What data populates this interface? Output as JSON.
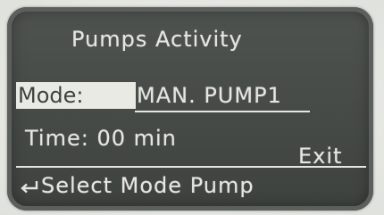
{
  "screen": {
    "title": "Pumps Activity",
    "mode_label": "Mode:",
    "mode_value": "MAN. PUMP1",
    "time_text": "Time: 00 min",
    "exit_label": "Exit",
    "footer_text": "Select Mode Pump",
    "footer_icon": "enter-return-icon"
  },
  "colors": {
    "lcd_background": "#464a47",
    "lcd_foreground": "#e6e6e0",
    "bezel": "#e9ebe6"
  }
}
